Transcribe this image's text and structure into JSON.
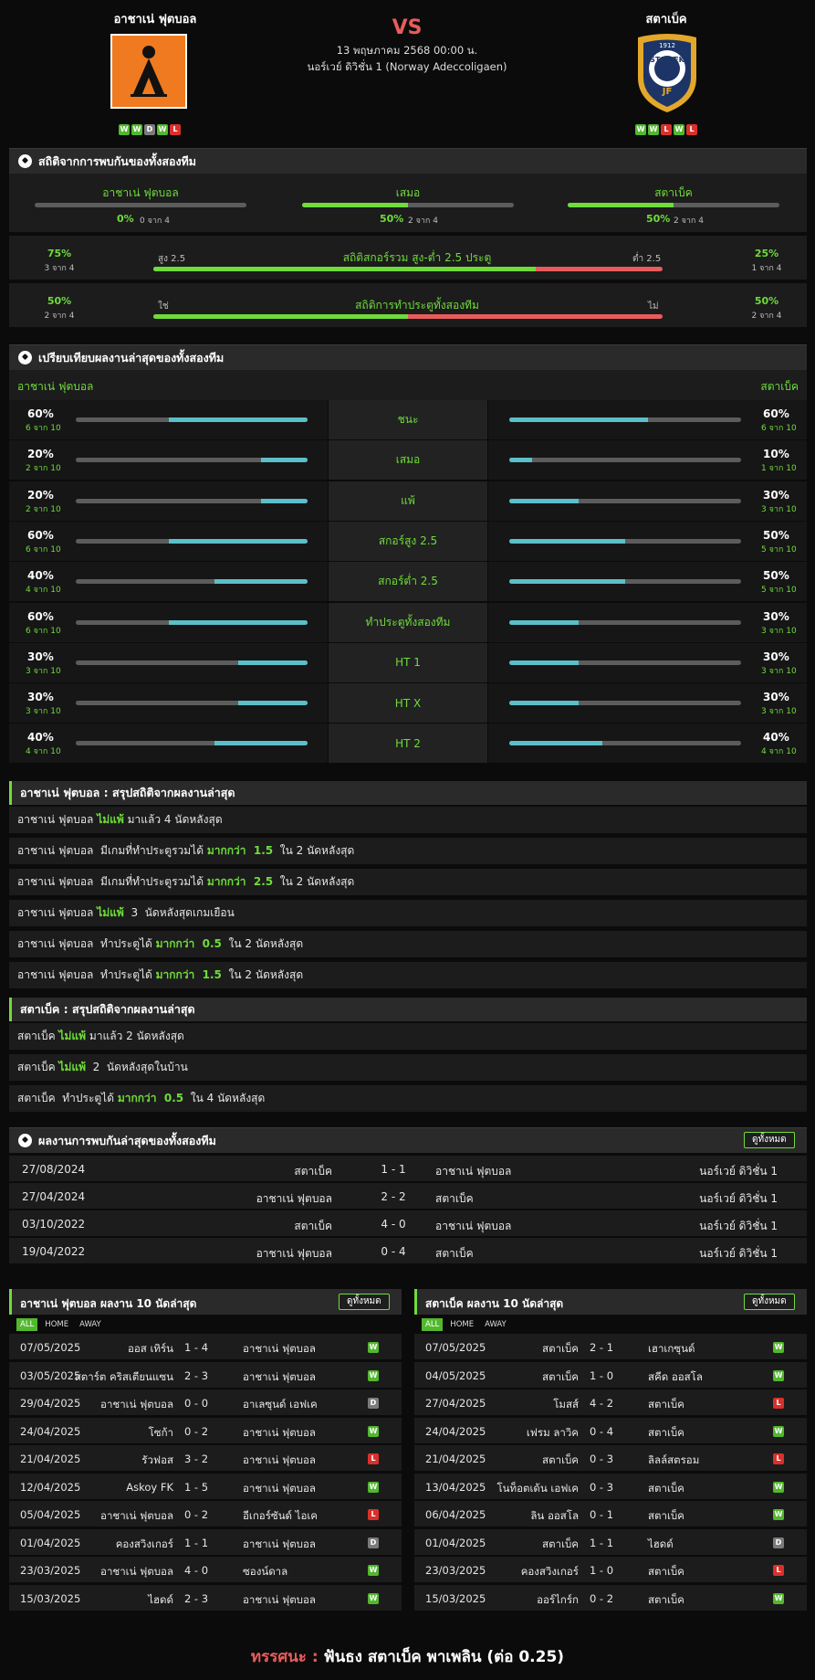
{
  "header": {
    "home_name": "อาชาเน่ ฟุตบอล",
    "away_name": "สตาเบ็ค",
    "vs": "VS",
    "datetime": "13 พฤษภาคม 2568 00:00 น.",
    "league": "นอร์เวย์ ดิวิชั่น 1 (Norway Adeccoligaen)",
    "home_form": [
      "W",
      "W",
      "D",
      "W",
      "L"
    ],
    "away_form": [
      "W",
      "W",
      "L",
      "W",
      "L"
    ],
    "away_logo_text": "JF",
    "away_logo_ring": "STABÆK",
    "away_logo_year": "1912"
  },
  "h2h_stats": {
    "title": "สถิติจากการพบกันของทั้งสองทีม",
    "home_label": "อาชาเน่ ฟุตบอล",
    "home_pct": "0%",
    "home_sub": "0 จาก 4",
    "home_val": 0,
    "draw_label": "เสมอ",
    "draw_pct": "50%",
    "draw_sub": "2 จาก 4",
    "draw_val": 0.5,
    "away_label": "สตาเบ็ค",
    "away_pct": "50%",
    "away_sub": "2 จาก 4",
    "away_val": 0.5,
    "ou": {
      "left_pct": "75%",
      "left_sub": "3 จาก 4",
      "over": "สูง 2.5",
      "title": "สถิติสกอร์รวม สูง-ต่ำ 2.5 ประตู",
      "under": "ต่ำ 2.5",
      "right_pct": "25%",
      "right_sub": "1 จาก 4",
      "value": 0.75
    },
    "btts": {
      "left_pct": "50%",
      "left_sub": "2 จาก 4",
      "yes": "ใช่",
      "title": "สถิติการทำประตูทั้งสองทีม",
      "no": "ไม่",
      "right_pct": "50%",
      "right_sub": "2 จาก 4",
      "value": 0.5
    }
  },
  "recent_compare": {
    "title": "เปรียบเทียบผลงานล่าสุดของทั้งสองทีม",
    "home_label": "อาชาเน่ ฟุตบอล",
    "away_label": "สตาเบ็ค",
    "rows": [
      {
        "label": "ชนะ",
        "hp": "60%",
        "hs": "6 จาก 10",
        "hv": 0.6,
        "ap": "60%",
        "as": "6 จาก 10",
        "av": 0.6
      },
      {
        "label": "เสมอ",
        "hp": "20%",
        "hs": "2 จาก 10",
        "hv": 0.2,
        "ap": "10%",
        "as": "1 จาก 10",
        "av": 0.1
      },
      {
        "label": "แพ้",
        "hp": "20%",
        "hs": "2 จาก 10",
        "hv": 0.2,
        "ap": "30%",
        "as": "3 จาก 10",
        "av": 0.3
      },
      {
        "label": "สกอร์สูง 2.5",
        "hp": "60%",
        "hs": "6 จาก 10",
        "hv": 0.6,
        "ap": "50%",
        "as": "5 จาก 10",
        "av": 0.5
      },
      {
        "label": "สกอร์ต่ำ 2.5",
        "hp": "40%",
        "hs": "4 จาก 10",
        "hv": 0.4,
        "ap": "50%",
        "as": "5 จาก 10",
        "av": 0.5
      },
      {
        "label": "ทำประตูทั้งสองทีม",
        "hp": "60%",
        "hs": "6 จาก 10",
        "hv": 0.6,
        "ap": "30%",
        "as": "3 จาก 10",
        "av": 0.3
      },
      {
        "label": "HT 1",
        "hp": "30%",
        "hs": "3 จาก 10",
        "hv": 0.3,
        "ap": "30%",
        "as": "3 จาก 10",
        "av": 0.3
      },
      {
        "label": "HT X",
        "hp": "30%",
        "hs": "3 จาก 10",
        "hv": 0.3,
        "ap": "30%",
        "as": "3 จาก 10",
        "av": 0.3
      },
      {
        "label": "HT 2",
        "hp": "40%",
        "hs": "4 จาก 10",
        "hv": 0.4,
        "ap": "40%",
        "as": "4 จาก 10",
        "av": 0.4
      }
    ]
  },
  "home_summary": {
    "title": "อาชาเน่ ฟุตบอล : สรุปสถิติจากผลงานล่าสุด",
    "rows": [
      [
        "อาชาเน่ ฟุตบอล ",
        "ไม่แพ้",
        " มาแล้ว 4 นัดหลังสุด"
      ],
      [
        "อาชาเน่ ฟุตบอล  มีเกมที่ทำประตูรวมได้ ",
        "มากกว่า  1.5",
        "  ใน 2 นัดหลังสุด"
      ],
      [
        "อาชาเน่ ฟุตบอล  มีเกมที่ทำประตูรวมได้ ",
        "มากกว่า  2.5",
        "  ใน 2 นัดหลังสุด"
      ],
      [
        "อาชาเน่ ฟุตบอล ",
        "ไม่แพ้",
        "  3  นัดหลังสุดเกมเยือน"
      ],
      [
        "อาชาเน่ ฟุตบอล  ทำประตูได้ ",
        "มากกว่า  0.5",
        "  ใน 2 นัดหลังสุด"
      ],
      [
        "อาชาเน่ ฟุตบอล  ทำประตูได้ ",
        "มากกว่า  1.5",
        "  ใน 2 นัดหลังสุด"
      ]
    ]
  },
  "away_summary": {
    "title": "สตาเบ็ค : สรุปสถิติจากผลงานล่าสุด",
    "rows": [
      [
        "สตาเบ็ค ",
        "ไม่แพ้",
        " มาแล้ว 2 นัดหลังสุด"
      ],
      [
        "สตาเบ็ค ",
        "ไม่แพ้",
        "  2  นัดหลังสุดในบ้าน"
      ],
      [
        "สตาเบ็ค  ทำประตูได้ ",
        "มากกว่า  0.5",
        "  ใน 4 นัดหลังสุด"
      ]
    ]
  },
  "h2h_matches": {
    "title": "ผลงานการพบกันล่าสุดของทั้งสองทีม",
    "view_all": "ดูทั้งหมด",
    "rows": [
      {
        "date": "27/08/2024",
        "home": "สตาเบ็ค",
        "score": "1 - 1",
        "away": "อาชาเน่ ฟุตบอล",
        "league": "นอร์เวย์ ดิวิชั่น 1"
      },
      {
        "date": "27/04/2024",
        "home": "อาชาเน่ ฟุตบอล",
        "score": "2 - 2",
        "away": "สตาเบ็ค",
        "league": "นอร์เวย์ ดิวิชั่น 1"
      },
      {
        "date": "03/10/2022",
        "home": "สตาเบ็ค",
        "score": "4 - 0",
        "away": "อาชาเน่ ฟุตบอล",
        "league": "นอร์เวย์ ดิวิชั่น 1"
      },
      {
        "date": "19/04/2022",
        "home": "อาชาเน่ ฟุตบอล",
        "score": "0 - 4",
        "away": "สตาเบ็ค",
        "league": "นอร์เวย์ ดิวิชั่น 1"
      }
    ]
  },
  "home_last10": {
    "title": "อาชาเน่ ฟุตบอล ผลงาน 10 นัดล่าสุด",
    "view_all": "ดูทั้งหมด",
    "tabs": [
      "ALL",
      "HOME",
      "AWAY"
    ],
    "rows": [
      {
        "date": "07/05/2025",
        "home": "ออส เทิร์น",
        "score": "1 - 4",
        "away": "อาชาเน่ ฟุตบอล",
        "res": "W"
      },
      {
        "date": "03/05/2025",
        "home": "สตาร์ต คริสเตียนแซน",
        "score": "2 - 3",
        "away": "อาชาเน่ ฟุตบอล",
        "res": "W"
      },
      {
        "date": "29/04/2025",
        "home": "อาชาเน่ ฟุตบอล",
        "score": "0 - 0",
        "away": "อาเลซุนด์ เอฟเค",
        "res": "D"
      },
      {
        "date": "24/04/2025",
        "home": "โซก้า",
        "score": "0 - 2",
        "away": "อาชาเน่ ฟุตบอล",
        "res": "W"
      },
      {
        "date": "21/04/2025",
        "home": "รัวฟอส",
        "score": "3 - 2",
        "away": "อาชาเน่ ฟุตบอล",
        "res": "L"
      },
      {
        "date": "12/04/2025",
        "home": "Askoy FK",
        "score": "1 - 5",
        "away": "อาชาเน่ ฟุตบอล",
        "res": "W"
      },
      {
        "date": "05/04/2025",
        "home": "อาชาเน่ ฟุตบอล",
        "score": "0 - 2",
        "away": "อีเกอร์ซันด์ ไอเค",
        "res": "L"
      },
      {
        "date": "01/04/2025",
        "home": "คองสวิงเกอร์",
        "score": "1 - 1",
        "away": "อาชาเน่ ฟุตบอล",
        "res": "D"
      },
      {
        "date": "23/03/2025",
        "home": "อาชาเน่ ฟุตบอล",
        "score": "4 - 0",
        "away": "ซองน์ดาล",
        "res": "W"
      },
      {
        "date": "15/03/2025",
        "home": "ไฮดด์",
        "score": "2 - 3",
        "away": "อาชาเน่ ฟุตบอล",
        "res": "W"
      }
    ]
  },
  "away_last10": {
    "title": "สตาเบ็ค ผลงาน 10 นัดล่าสุด",
    "view_all": "ดูทั้งหมด",
    "tabs": [
      "ALL",
      "HOME",
      "AWAY"
    ],
    "rows": [
      {
        "date": "07/05/2025",
        "home": "สตาเบ็ค",
        "score": "2 - 1",
        "away": "เฮาเกซุนด์",
        "res": "W"
      },
      {
        "date": "04/05/2025",
        "home": "สตาเบ็ค",
        "score": "1 - 0",
        "away": "สคีด ออสโล",
        "res": "W"
      },
      {
        "date": "27/04/2025",
        "home": "โมสส์",
        "score": "4 - 2",
        "away": "สตาเบ็ค",
        "res": "L"
      },
      {
        "date": "24/04/2025",
        "home": "เฟรม ลาวิค",
        "score": "0 - 4",
        "away": "สตาเบ็ค",
        "res": "W"
      },
      {
        "date": "21/04/2025",
        "home": "สตาเบ็ค",
        "score": "0 - 3",
        "away": "ลิลล์สตรอม",
        "res": "L"
      },
      {
        "date": "13/04/2025",
        "home": "โนท็อตเด้น เอฟเค",
        "score": "0 - 3",
        "away": "สตาเบ็ค",
        "res": "W"
      },
      {
        "date": "06/04/2025",
        "home": "ลิน ออสโล",
        "score": "0 - 1",
        "away": "สตาเบ็ค",
        "res": "W"
      },
      {
        "date": "01/04/2025",
        "home": "สตาเบ็ค",
        "score": "1 - 1",
        "away": "ไฮดด์",
        "res": "D"
      },
      {
        "date": "23/03/2025",
        "home": "คองสวิงเกอร์",
        "score": "1 - 0",
        "away": "สตาเบ็ค",
        "res": "L"
      },
      {
        "date": "15/03/2025",
        "home": "ออร์ไกร์ก",
        "score": "0 - 2",
        "away": "สตาเบ็ค",
        "res": "W"
      }
    ]
  },
  "prediction": {
    "label": "ทรรศนะ :",
    "text": "ฟันธง สตาเบ็ค พาเพลิน (ต่อ 0.25)"
  },
  "colors": {
    "green": "#6fdc3a",
    "teal": "#5bbfc9",
    "red": "#e85c5c",
    "orange": "#f07a1f",
    "navy": "#1d3566",
    "gold": "#e3a72a"
  }
}
